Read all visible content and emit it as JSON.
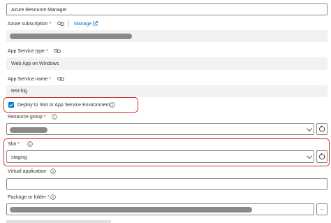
{
  "connection_type": "Azure Resource Manager",
  "azure_subscription": {
    "label": "Azure subscription",
    "required": "*",
    "manage_label": "Manage"
  },
  "app_service_type": {
    "label": "App Service type",
    "required": "*",
    "value": "Web App on Windows"
  },
  "app_service_name": {
    "label": "App Service name",
    "required": "*",
    "value": "test-hig"
  },
  "deploy_to_slot": {
    "label": "Deploy to Slot or App Service Environment",
    "checked": true
  },
  "resource_group": {
    "label": "Resource group",
    "required": "*"
  },
  "slot": {
    "label": "Slot",
    "required": "*",
    "value": "staging"
  },
  "virtual_application": {
    "label": "Virtual application",
    "value": ""
  },
  "package_or_folder": {
    "label": "Package or folder",
    "required": "*",
    "browse_label": "..."
  },
  "colors": {
    "accent": "#0078d4",
    "highlight": "#d0302a",
    "readonly_bg": "#f3f2f1"
  }
}
